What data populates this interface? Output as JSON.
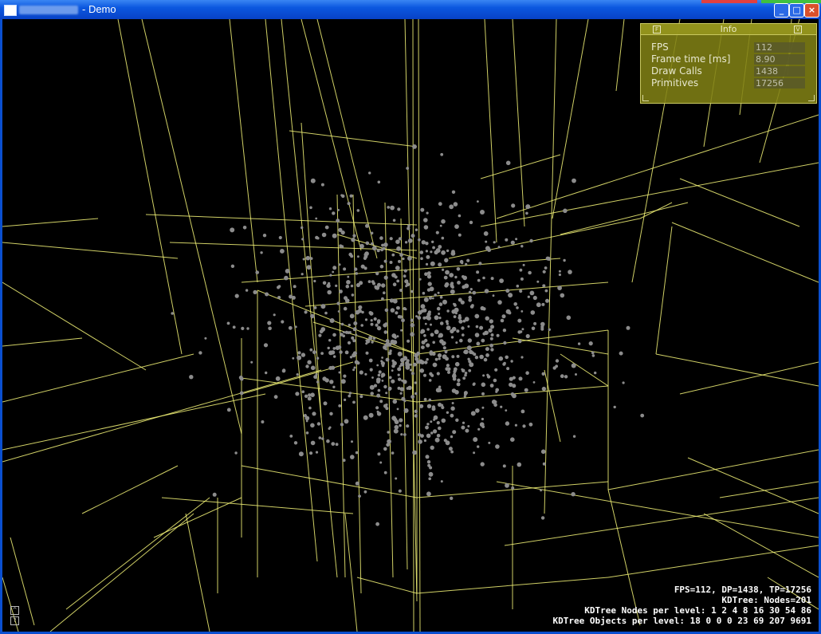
{
  "window": {
    "title_suffix": "- Demo",
    "minimize_glyph": "_",
    "maximize_glyph": "□",
    "close_glyph": "×"
  },
  "colors": {
    "kdtree_lines": "#f5f578",
    "objects": "#8c8c8c",
    "background": "#000000",
    "info_panel": "#80801a"
  },
  "info": {
    "title": "Info",
    "left_btn": "F",
    "right_btn": "V",
    "rows": [
      {
        "label": "FPS",
        "value": "112"
      },
      {
        "label": "Frame time [ms]",
        "value": "8.90"
      },
      {
        "label": "Draw Calls",
        "value": "1438"
      },
      {
        "label": "Primitives",
        "value": "17256"
      }
    ]
  },
  "stats": {
    "line1": "FPS=112, DP=1438, TP=17256",
    "line2": "KDTree: Nodes=201",
    "line3": "KDTree Nodes per level: 1 2 4 8 16 30 54 86",
    "line4": "KDTree Objects per level: 18 0 0 0 23 69 207 9691"
  },
  "side_icons": {
    "up_glyph": "^",
    "help_glyph": "?"
  }
}
